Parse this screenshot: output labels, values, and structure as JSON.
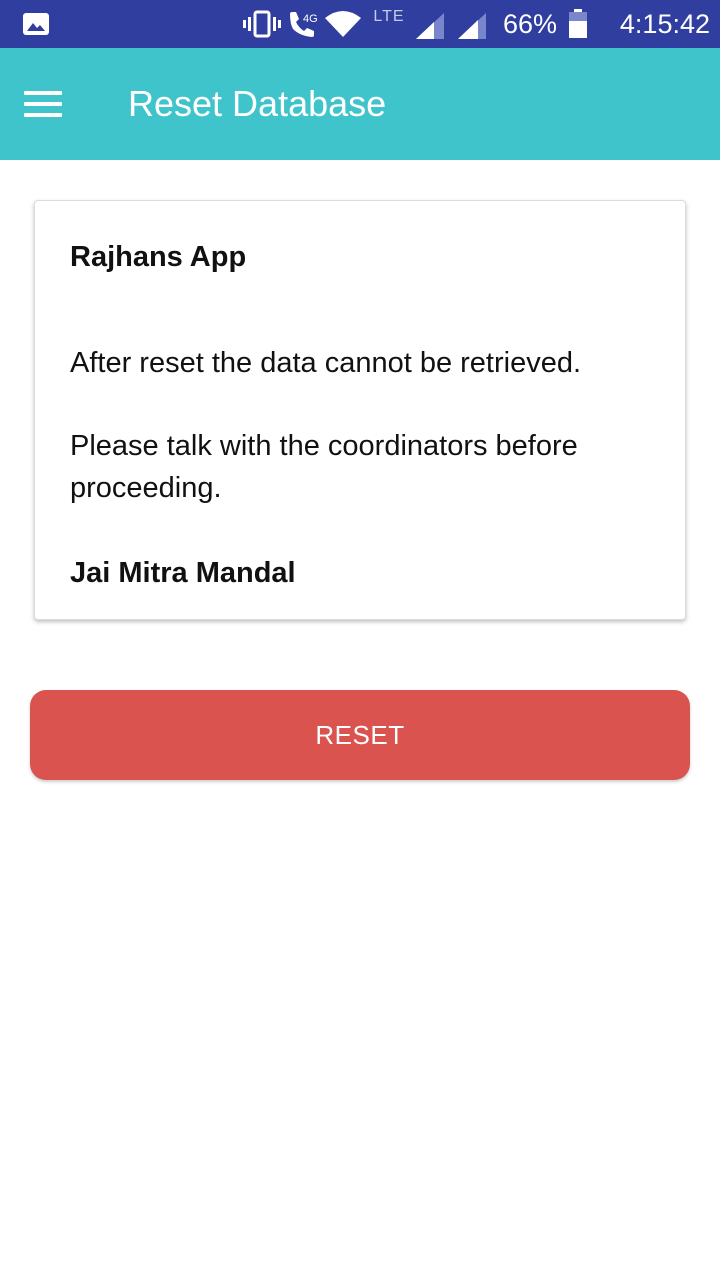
{
  "status_bar": {
    "network_type": "4G",
    "lte_label": "LTE",
    "battery_percent": "66%",
    "time": "4:15:42",
    "icons": [
      "gallery-icon",
      "vibrate-icon",
      "wifi-call-icon",
      "wifi-icon",
      "signal-icon",
      "signal-icon",
      "battery-icon"
    ]
  },
  "app_bar": {
    "title": "Reset Database",
    "menu_icon": "hamburger-menu-icon",
    "background": "#40c4cc"
  },
  "card": {
    "title": "Rajhans App",
    "warning": "After reset the data cannot be retrieved.",
    "advice": "Please talk with the coordinators before proceeding.",
    "signature": "Jai Mitra Mandal"
  },
  "reset_button": {
    "label": "RESET",
    "color": "#db534f"
  },
  "colors": {
    "status_bar": "#303f9f",
    "app_bar": "#40c4cc",
    "button": "#db534f"
  }
}
